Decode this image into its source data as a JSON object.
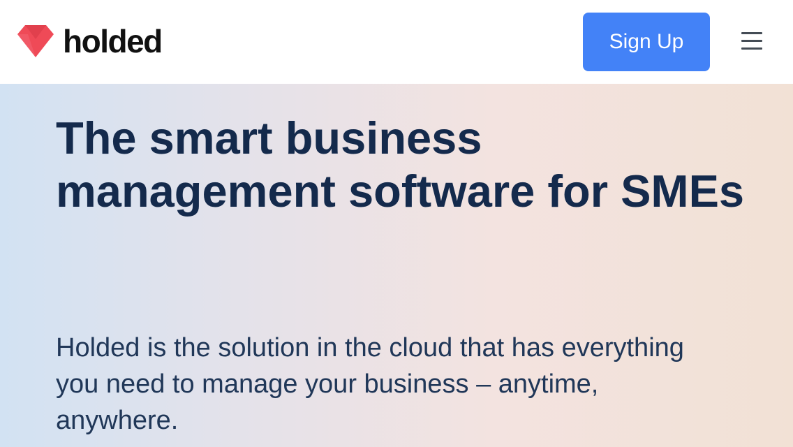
{
  "header": {
    "brand": "holded",
    "brand_color": "#ef4a57",
    "signup_label": "Sign Up",
    "signup_color": "#4382f7",
    "menu_icon": "hamburger-menu-icon"
  },
  "hero": {
    "title": "The smart business management software for SMEs",
    "subtitle": "Holded is the solution in the cloud that has everything you need to manage your business – anytime, anywhere."
  }
}
